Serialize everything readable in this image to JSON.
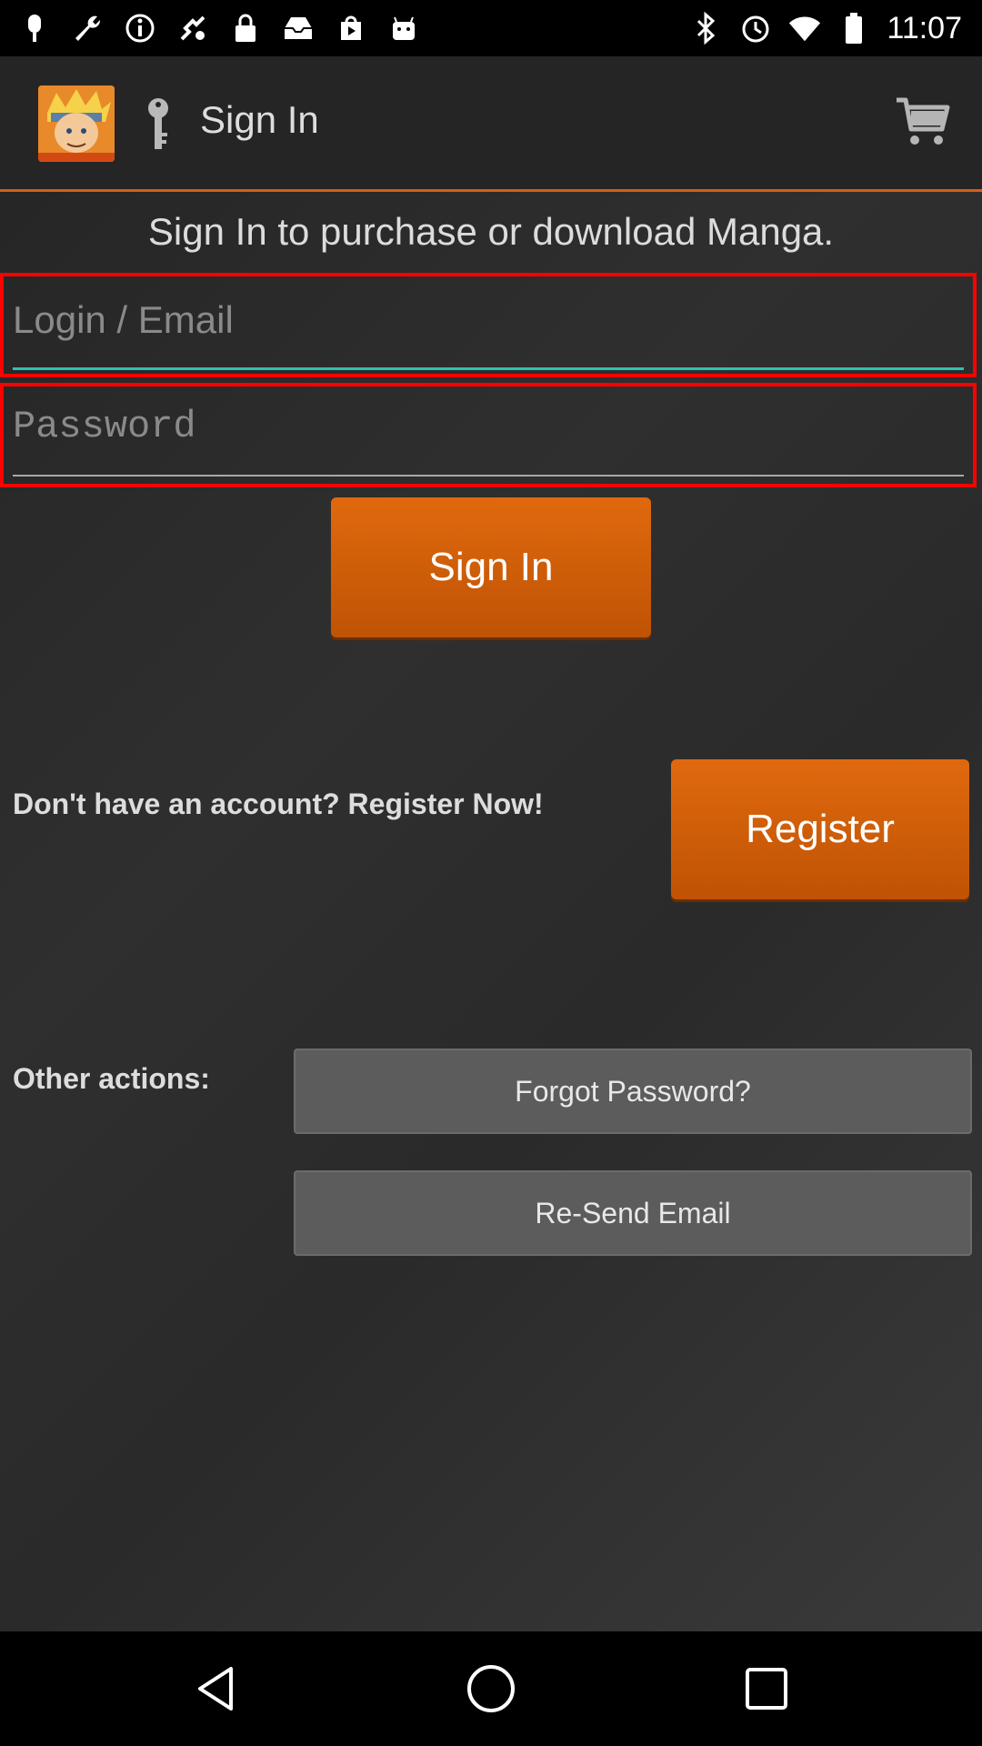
{
  "status_bar": {
    "time": "11:07",
    "left_icons": [
      "microphone-icon",
      "wrench-icon",
      "info-icon",
      "fake-gps-icon",
      "lock-icon",
      "inbox-icon",
      "play-store-icon",
      "android-icon"
    ],
    "right_icons": [
      "bluetooth-icon",
      "alarm-icon",
      "wifi-icon",
      "battery-icon"
    ]
  },
  "app_bar": {
    "title": "Sign In",
    "accent_color": "#d85d12"
  },
  "main": {
    "subtitle": "Sign In to purchase or download Manga.",
    "email_placeholder": "Login / Email",
    "password_placeholder": "Password",
    "sign_in_label": "Sign In",
    "register_prompt": "Don't have an account? Register Now!",
    "register_label": "Register",
    "other_actions_label": "Other actions:",
    "forgot_password_label": "Forgot Password?",
    "resend_email_label": "Re-Send Email"
  },
  "colors": {
    "button_orange": "#d05e08",
    "field_highlight": "#ff0000",
    "focus_underline": "#2fc0b0",
    "gray_button": "#5c5c5c"
  }
}
